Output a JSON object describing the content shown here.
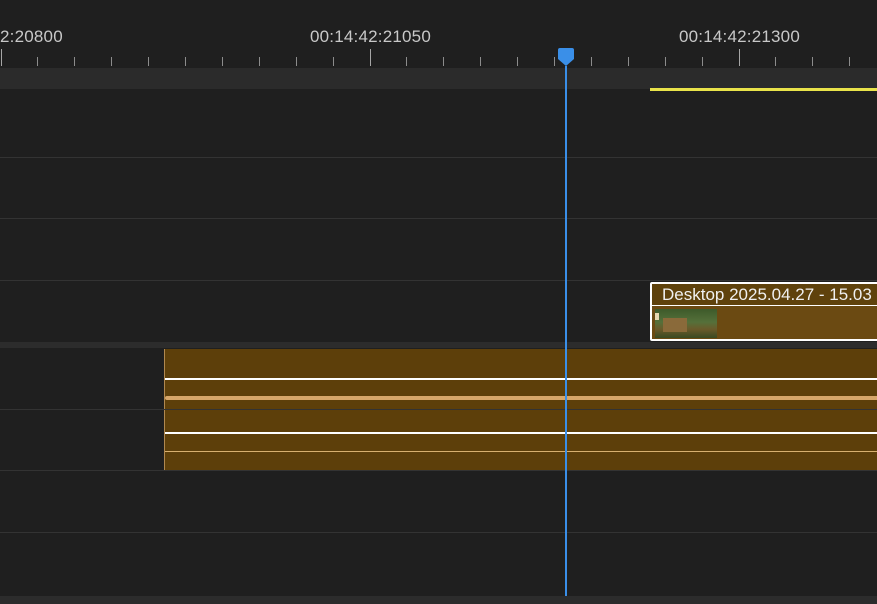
{
  "ruler": {
    "labels": [
      "2:20800",
      "00:14:42:21050",
      "00:14:42:21300"
    ]
  },
  "tracks": {
    "video_clip": {
      "name": "Desktop 2025.04.27 - 15.03"
    }
  },
  "colors": {
    "background": "#1f1f1f",
    "playhead": "#3a8fe8",
    "work_area": "#e9e34a",
    "clip": "#5d3f0a",
    "clip_selected_border": "#ffffff"
  },
  "icons": {
    "playhead": "playhead-marker-icon"
  }
}
